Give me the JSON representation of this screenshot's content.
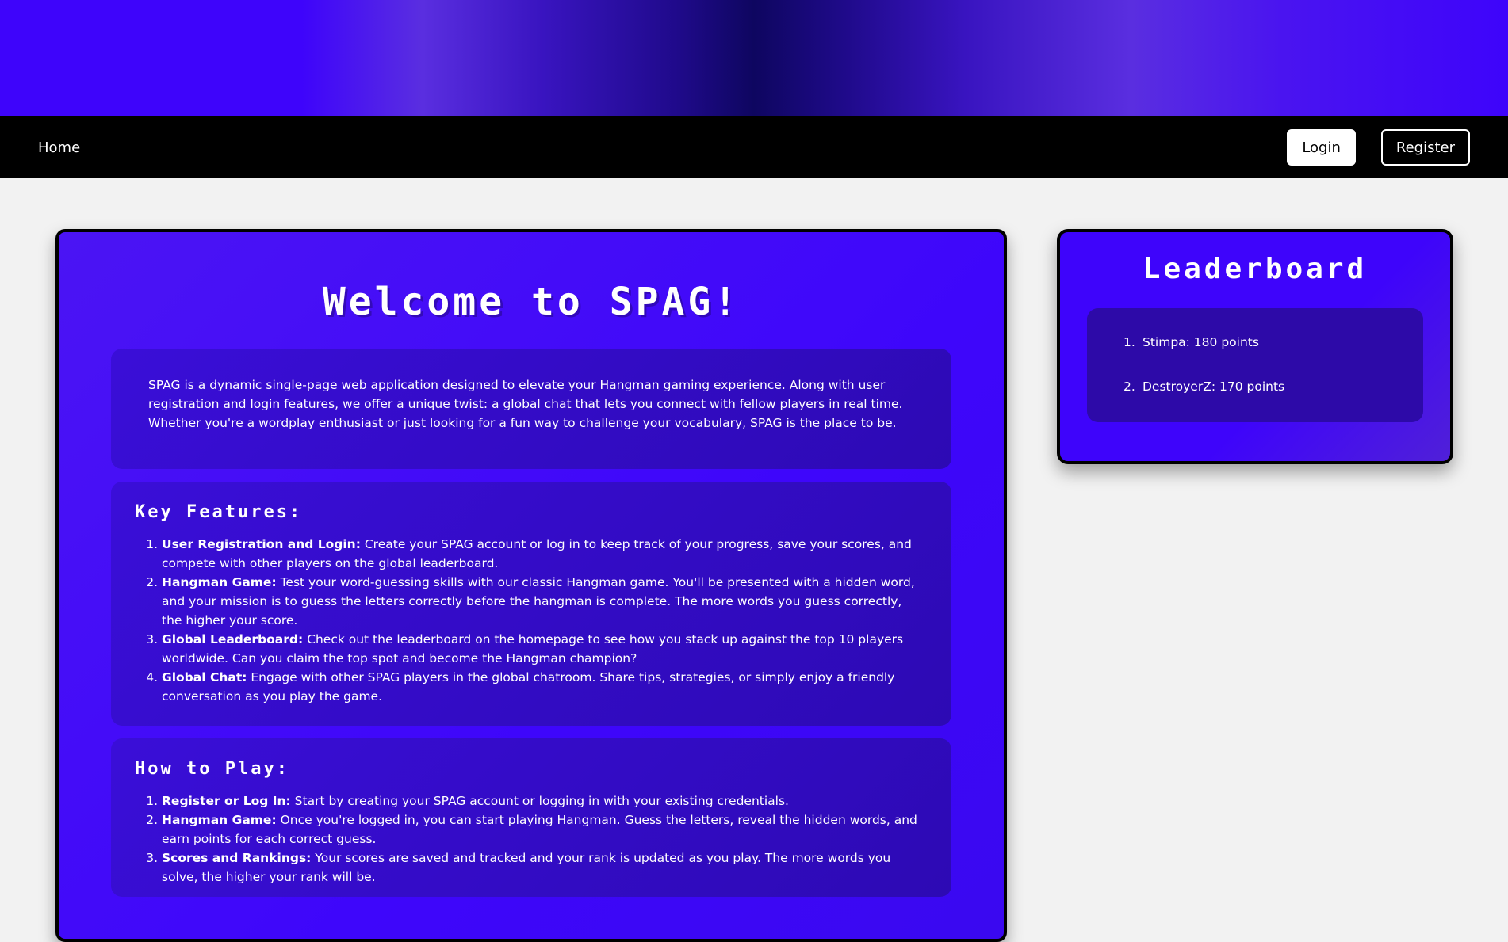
{
  "nav": {
    "home": "Home",
    "login": "Login",
    "register": "Register"
  },
  "main": {
    "title": "Welcome to SPAG!",
    "intro": "SPAG is a dynamic single-page web application designed to elevate your Hangman gaming experience. Along with user registration and login features, we offer a unique twist: a global chat that lets you connect with fellow players in real time. Whether you're a wordplay enthusiast or just looking for a fun way to challenge your vocabulary, SPAG is the place to be.",
    "features_heading": "Key Features:",
    "features": [
      {
        "title": "User Registration and Login:",
        "text": " Create your SPAG account or log in to keep track of your progress, save your scores, and compete with other players on the global leaderboard."
      },
      {
        "title": "Hangman Game:",
        "text": " Test your word-guessing skills with our classic Hangman game. You'll be presented with a hidden word, and your mission is to guess the letters correctly before the hangman is complete. The more words you guess correctly, the higher your score."
      },
      {
        "title": "Global Leaderboard:",
        "text": " Check out the leaderboard on the homepage to see how you stack up against the top 10 players worldwide. Can you claim the top spot and become the Hangman champion?"
      },
      {
        "title": "Global Chat:",
        "text": " Engage with other SPAG players in the global chatroom. Share tips, strategies, or simply enjoy a friendly conversation as you play the game."
      }
    ],
    "howto_heading": "How to Play:",
    "howto": [
      {
        "title": "Register or Log In:",
        "text": " Start by creating your SPAG account or logging in with your existing credentials."
      },
      {
        "title": "Hangman Game:",
        "text": " Once you're logged in, you can start playing Hangman. Guess the letters, reveal the hidden words, and earn points for each correct guess."
      },
      {
        "title": "Scores and Rankings:",
        "text": " Your scores are saved and tracked and your rank is updated as you play. The more words you solve, the higher your rank will be."
      }
    ]
  },
  "leaderboard": {
    "title": "Leaderboard",
    "entries": [
      {
        "rank": "1.",
        "text": "Stimpa: 180 points"
      },
      {
        "rank": "2.",
        "text": "DestroyerZ: 170 points"
      }
    ]
  }
}
